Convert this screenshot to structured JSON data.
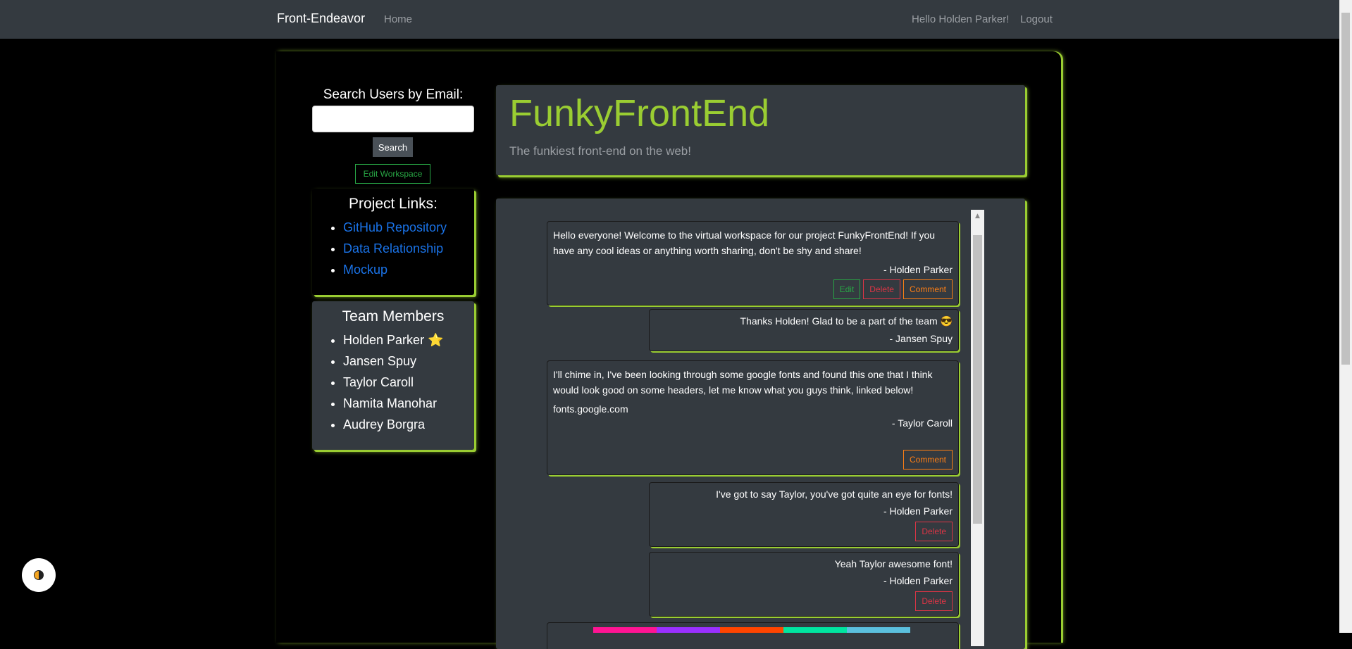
{
  "navbar": {
    "brand": "Front-Endeavor",
    "home": "Home",
    "greeting": "Hello Holden Parker!",
    "logout": "Logout"
  },
  "sidebar": {
    "search_label": "Search Users by Email:",
    "search_value": "",
    "search_button": "Search",
    "edit_workspace": "Edit Workspace",
    "project_links_title": "Project Links:",
    "project_links": [
      "GitHub Repository",
      "Data Relationship",
      "Mockup"
    ],
    "team_title": "Team Members",
    "team_members": [
      "Holden Parker ⭐",
      "Jansen Spuy",
      "Taylor Caroll",
      "Namita Manohar",
      "Audrey Borgra"
    ]
  },
  "header": {
    "title": "FunkyFrontEnd",
    "tagline": "The funkiest front-end on the web!"
  },
  "posts": [
    {
      "text": "Hello everyone! Welcome to the virtual workspace for our project FunkyFrontEnd! If you have any cool ideas or anything worth sharing, don't be shy and share!",
      "author": "- Holden Parker",
      "buttons": [
        "Edit",
        "Delete",
        "Comment"
      ]
    },
    {
      "text": "Thanks Holden! Glad to be a part of the team 😎",
      "author": "- Jansen Spuy"
    },
    {
      "text": "I'll chime in, I've been looking through some google fonts and found this one that I think would look good on some headers, let me know what you guys think, linked below!",
      "link": "fonts.google.com",
      "author": "- Taylor Caroll",
      "buttons": [
        "Comment"
      ]
    },
    {
      "text": "I've got to say Taylor, you've got quite an eye for fonts!",
      "author": "- Holden Parker",
      "buttons": [
        "Delete"
      ]
    },
    {
      "text": "Yeah Taylor awesome font!",
      "author": "- Holden Parker",
      "buttons": [
        "Delete"
      ]
    }
  ],
  "colors": {
    "accent": "#9acd32",
    "strip": [
      "#ff1493",
      "#9b30ff",
      "#ff4500",
      "#00e5a0",
      "#5bc0de"
    ]
  }
}
